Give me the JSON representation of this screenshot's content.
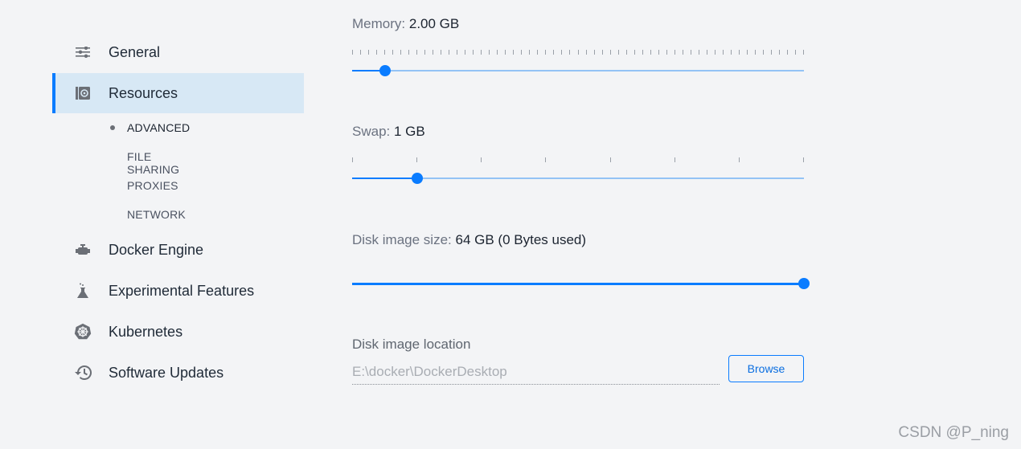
{
  "sidebar": {
    "items": [
      {
        "label": "General",
        "icon": "sliders-icon"
      },
      {
        "label": "Resources",
        "icon": "resources-icon",
        "active": true
      },
      {
        "label": "Docker Engine",
        "icon": "engine-icon"
      },
      {
        "label": "Experimental Features",
        "icon": "flask-icon"
      },
      {
        "label": "Kubernetes",
        "icon": "kubernetes-icon"
      },
      {
        "label": "Software Updates",
        "icon": "history-icon"
      }
    ],
    "subitems": [
      {
        "label": "ADVANCED",
        "current": true
      },
      {
        "label": "FILE SHARING"
      },
      {
        "label": "PROXIES"
      },
      {
        "label": "NETWORK"
      }
    ]
  },
  "main": {
    "memory": {
      "label": "Memory:",
      "value_text": "2.00 GB",
      "value": 2,
      "min": 1,
      "max": 15,
      "step": 0.25
    },
    "swap": {
      "label": "Swap:",
      "value_text": "1 GB",
      "value": 1,
      "min": 0.5,
      "max": 4,
      "step": 0.5
    },
    "disk": {
      "label": "Disk image size:",
      "value_text": "64 GB (0 Bytes used)",
      "value": 64,
      "min": 0,
      "max": 64
    },
    "location": {
      "label": "Disk image location",
      "value": "E:\\docker\\DockerDesktop",
      "browse_label": "Browse"
    }
  },
  "watermark": "CSDN @P_ning",
  "colors": {
    "accent": "#0a7cff",
    "track": "#93c3f5",
    "active_bg": "#d7e8f5",
    "background": "#f3f4f6"
  }
}
